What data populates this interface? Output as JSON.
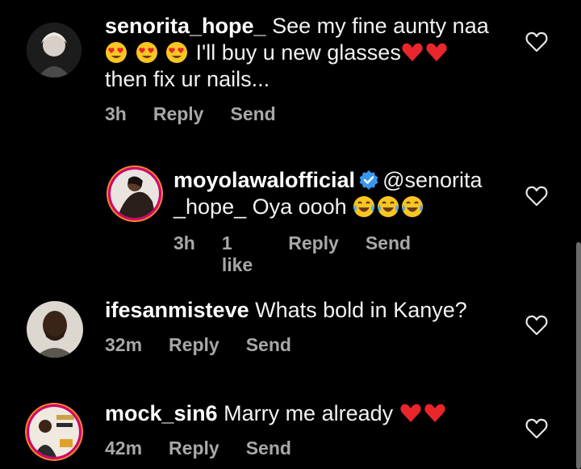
{
  "comments": [
    {
      "username": "senorita_hope_",
      "text_line1": " See my fine aunty naa",
      "text_line2": " I'll buy u new glasses",
      "text_line3": "then fix ur nails...",
      "time": "3h",
      "reply": "Reply",
      "send": "Send"
    },
    {
      "username": "moyolawalofficial",
      "mention_part1": "@senorita",
      "mention_part2": "_hope_",
      "text": " Oya oooh ",
      "time": "3h",
      "likes": "1 like",
      "reply": "Reply",
      "send": "Send"
    },
    {
      "username": "ifesanmisteve",
      "text": " Whats bold in Kanye?",
      "time": "32m",
      "reply": "Reply",
      "send": "Send"
    },
    {
      "username": "mock_sin6",
      "text": " Marry me already ",
      "time": "42m",
      "reply": "Reply",
      "send": "Send"
    }
  ],
  "colors": {
    "background": "#000000",
    "meta_text": "#a8a8a8",
    "verified_blue": "#3897f0",
    "heart_red": "#e8262b"
  },
  "icons": [
    "heart-outline-icon",
    "verified-badge-icon",
    "heart-eyes-emoji",
    "red-heart-emoji",
    "tears-of-joy-emoji"
  ]
}
